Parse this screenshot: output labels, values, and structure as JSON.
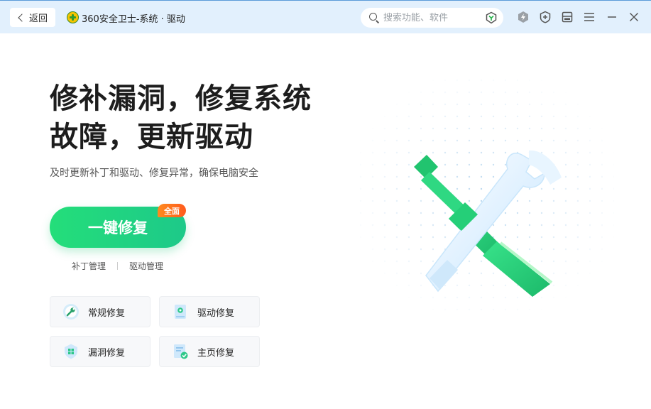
{
  "titlebar": {
    "back_label": "返回",
    "app_title": "360安全卫士-系统 · 驱动",
    "search_placeholder": "搜索功能、软件"
  },
  "hero": {
    "title_line1": "修补漏洞，修复系统",
    "title_line2": "故障，更新驱动",
    "subtitle": "及时更新补丁和驱动、修复异常，确保电脑安全"
  },
  "action": {
    "main_label": "一键修复",
    "badge": "全面"
  },
  "links": {
    "patch": "补丁管理",
    "driver": "驱动管理"
  },
  "cards": [
    {
      "label": "常规修复",
      "icon": "wrench-icon"
    },
    {
      "label": "驱动修复",
      "icon": "driver-icon"
    },
    {
      "label": "漏洞修复",
      "icon": "shield-windows-icon"
    },
    {
      "label": "主页修复",
      "icon": "homepage-icon"
    }
  ],
  "colors": {
    "accent_green": "#1fd37f",
    "badge_orange": "#ff6a1e",
    "titlebar_bg": "#e2f0fd"
  }
}
